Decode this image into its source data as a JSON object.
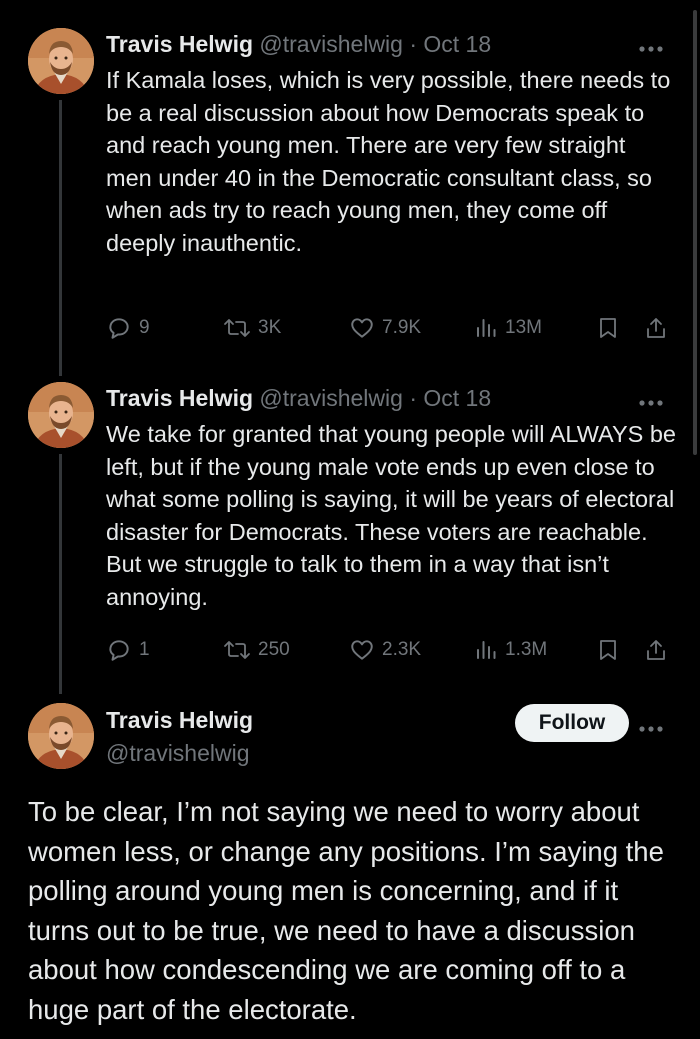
{
  "tweets": [
    {
      "name": "Travis Helwig",
      "handle": "@travishelwig",
      "separator": "·",
      "date": "Oct 18",
      "text": "If Kamala loses, which is very possible, there needs to be a real discussion about how Democrats speak to and reach young men. There are very few straight men under 40 in the Democratic consultant class, so when ads try to reach young men, they come off deeply inauthentic.",
      "replies": "9",
      "reposts": "3K",
      "likes": "7.9K",
      "views": "13M"
    },
    {
      "name": "Travis Helwig",
      "handle": "@travishelwig",
      "separator": "·",
      "date": "Oct 18",
      "text": "We take for granted that young people will ALWAYS be left, but if the young male vote ends up even close to what some polling is saying, it will be years of electoral disaster for Democrats. These voters are reachable. But we struggle to talk to them in a way that isn’t annoying.",
      "replies": "1",
      "reposts": "250",
      "likes": "2.3K",
      "views": "1.3M"
    }
  ],
  "main_tweet": {
    "name": "Travis Helwig",
    "handle": "@travishelwig",
    "follow_label": "Follow",
    "text": "To be clear, I’m not saying we need to worry about women less, or change any positions. I’m saying the polling around young men is concerning, and if it turns out to be true, we need to have a discussion about how condescending we are coming off to a huge part of the electorate."
  },
  "icons": {
    "more": "more-horizontal-icon",
    "reply": "reply-icon",
    "repost": "repost-icon",
    "like": "like-icon",
    "views": "views-icon",
    "bookmark": "bookmark-icon",
    "share": "share-icon"
  },
  "colors": {
    "background": "#000000",
    "text": "#e7e9ea",
    "secondary": "#71767b",
    "follow_bg": "#eff3f4"
  }
}
